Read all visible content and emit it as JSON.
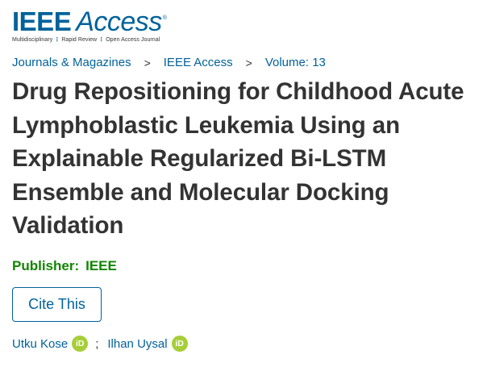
{
  "brand": {
    "name_bold": "IEEE",
    "name_light": "Access",
    "trademark": "®",
    "tagline_parts": [
      "Multidisciplinary",
      "Rapid Review",
      "Open Access Journal"
    ],
    "tagline_separator": "⋮",
    "color": "#00629b"
  },
  "breadcrumb": {
    "items": [
      "Journals & Magazines",
      "IEEE Access",
      "Volume: 13"
    ],
    "separator": ">"
  },
  "article": {
    "title": "Drug Repositioning for Childhood Acute Lymphoblastic Leukemia Using an Explainable Regularized Bi-LSTM Ensemble and Molecular Docking Validation"
  },
  "publisher": {
    "label": "Publisher:",
    "value": "IEEE",
    "color": "#118600"
  },
  "cite_button": {
    "label": "Cite This"
  },
  "authors": {
    "list": [
      {
        "name": "Utku Kose",
        "orcid_badge": "iD"
      },
      {
        "name": "Ilhan Uysal",
        "orcid_badge": "iD"
      }
    ],
    "separator": ";",
    "orcid_color": "#a6ce39"
  }
}
